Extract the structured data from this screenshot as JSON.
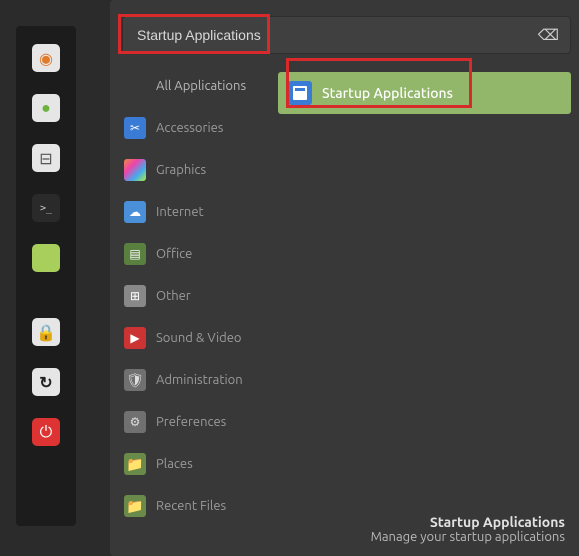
{
  "search": {
    "value": "Startup Applications"
  },
  "panel_icons": [
    {
      "name": "firefox-icon",
      "bg": "#e6e6e6",
      "fg": "#e07b2e",
      "glyph": "◉"
    },
    {
      "name": "apps-grid-icon",
      "bg": "#e6e6e6",
      "fg": "#6cb33f",
      "glyph": "●"
    },
    {
      "name": "settings-toggle-icon",
      "bg": "#e6e6e6",
      "fg": "#555",
      "glyph": "⊟"
    },
    {
      "name": "terminal-icon",
      "bg": "#2a2a2a",
      "fg": "#ccc",
      "glyph": ">_"
    },
    {
      "name": "files-icon",
      "bg": "#a8cf5b",
      "fg": "#a8cf5b",
      "glyph": " "
    },
    {
      "name": "lock-icon",
      "bg": "#e6e6e6",
      "fg": "#222",
      "glyph": "🔒"
    },
    {
      "name": "reload-icon",
      "bg": "#e6e6e6",
      "fg": "#222",
      "glyph": "↻"
    },
    {
      "name": "power-icon",
      "bg": "#d33",
      "fg": "#fff",
      "glyph": "⏻"
    }
  ],
  "categories": [
    {
      "name": "all-applications",
      "label": "All Applications",
      "icon_bg": "transparent",
      "glyph": ""
    },
    {
      "name": "accessories",
      "label": "Accessories",
      "icon_bg": "#3a7bd5",
      "glyph": "✂"
    },
    {
      "name": "graphics",
      "label": "Graphics",
      "icon_bg": "linear-gradient(135deg,#e84,#4ae,#ae4)",
      "glyph": ""
    },
    {
      "name": "internet",
      "label": "Internet",
      "icon_bg": "#4a90d9",
      "glyph": "☁"
    },
    {
      "name": "office",
      "label": "Office",
      "icon_bg": "#5a8040",
      "glyph": "▤"
    },
    {
      "name": "other",
      "label": "Other",
      "icon_bg": "#888",
      "glyph": "⊞"
    },
    {
      "name": "sound-video",
      "label": "Sound & Video",
      "icon_bg": "#c33",
      "glyph": "▶"
    },
    {
      "name": "administration",
      "label": "Administration",
      "icon_bg": "#707070",
      "glyph": "🛡"
    },
    {
      "name": "preferences",
      "label": "Preferences",
      "icon_bg": "#707070",
      "glyph": "⚙"
    },
    {
      "name": "places",
      "label": "Places",
      "icon_bg": "#6a8a4a",
      "glyph": "📁"
    },
    {
      "name": "recent-files",
      "label": "Recent Files",
      "icon_bg": "#6a8a4a",
      "glyph": "📁"
    }
  ],
  "result": {
    "label": "Startup Applications"
  },
  "description": {
    "title": "Startup Applications",
    "subtitle": "Manage your startup applications"
  }
}
